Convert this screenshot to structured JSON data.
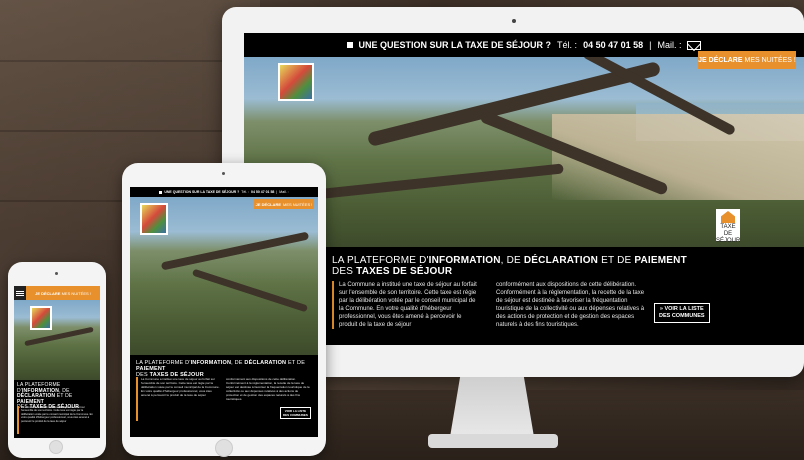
{
  "banner": {
    "question": "UNE QUESTION SUR LA TAXE DE SÉJOUR ?",
    "tel_label": "Tél. :",
    "tel_number": "04 50 47 01 58",
    "separator": "|",
    "mail_label": "Mail. :"
  },
  "declare": {
    "bold": "JE DÉCLARE",
    "light": "MES NUITÉES !"
  },
  "taxe_badge": {
    "line1": "TAXE DE",
    "line2": "SÉJOUR"
  },
  "headline": {
    "part1": "LA PLATEFORME D'",
    "part2": "INFORMATION",
    "part3": ", DE ",
    "part4": "DÉCLARATION",
    "part5": " ET DE ",
    "part6": "PAIEMENT",
    "part7": "DES ",
    "part8": "TAXES DE SÉJOUR"
  },
  "body": {
    "col1": "La Commune a institué une taxe de séjour au forfait sur l'ensemble de son territoire. Cette taxe est régie par la délibération votée par le conseil municipal de la Commune. En votre qualité d'hébergeur professionnel, vous êtes amené à percevoir le produit de la taxe de séjour",
    "col2": "conformément aux dispositions de cette délibération. Conformément à la réglementation, la recette de la taxe de séjour est destinée à favoriser la fréquentation touristique de la collectivité ou aux dépenses relatives à des actions de protection et de gestion des espaces naturels à des fins touristiques."
  },
  "list_button": {
    "prefix": "» ",
    "line1": "VOIR LA LISTE",
    "line2": "DES COMMUNES"
  },
  "colors": {
    "accent": "#e8902c",
    "bar": "#000000"
  },
  "icons": [
    "square-bullet-icon",
    "mail-icon",
    "house-icon",
    "hamburger-menu-icon"
  ]
}
